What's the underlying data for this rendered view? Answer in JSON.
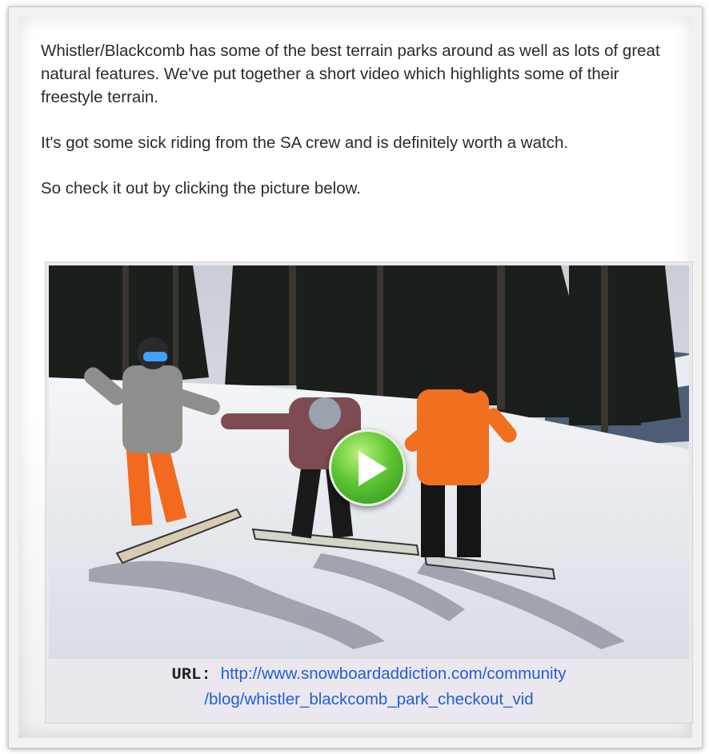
{
  "post": {
    "paragraphs": [
      "Whistler/Blackcomb has some of the best terrain parks around as well as lots of great natural features. We've put together a short video which highlights some of their freestyle terrain.",
      "It's got some sick riding from the SA crew and is definitely worth a watch.",
      "So check it out by clicking the picture below."
    ]
  },
  "video": {
    "play_icon": "play-icon",
    "url_label": "URL:",
    "url_line1": "http://www.snowboardaddiction.com/community",
    "url_line2": "/blog/whistler_blackcomb_park_checkout_vid"
  },
  "colors": {
    "link": "#1f5fd6",
    "play_green": "#5ec634",
    "jacket_orange": "#f07020",
    "text": "#2b2b2b"
  }
}
